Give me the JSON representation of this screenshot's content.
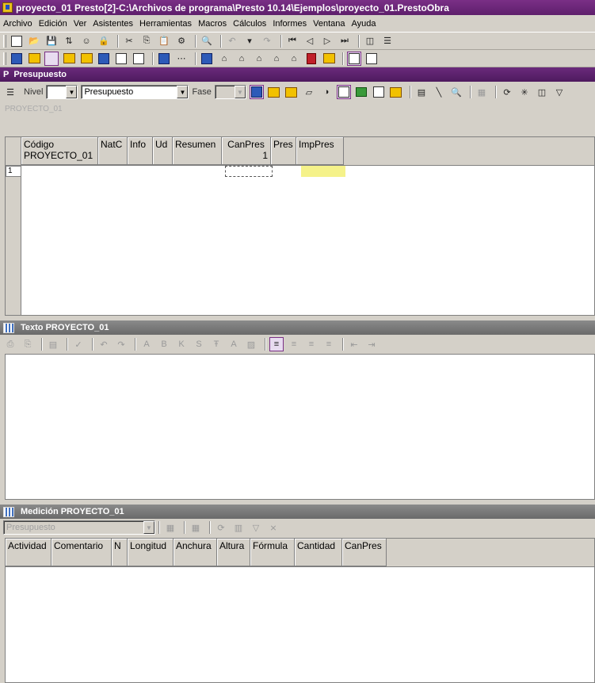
{
  "window": {
    "title": "proyecto_01 Presto[2]-C:\\Archivos de programa\\Presto 10.14\\Ejemplos\\proyecto_01.PrestoObra"
  },
  "menu": [
    "Archivo",
    "Edición",
    "Ver",
    "Asistentes",
    "Herramientas",
    "Macros",
    "Cálculos",
    "Informes",
    "Ventana",
    "Ayuda"
  ],
  "presupuesto": {
    "title_tag": "P",
    "title": "Presupuesto",
    "nivel_label": "Nivel",
    "nivel_value": "",
    "view_value": "Presupuesto",
    "fase_label": "Fase",
    "fase_value": "",
    "code_path": "PROYECTO_01",
    "columns": [
      {
        "h1": "Código",
        "h2": "PROYECTO_01"
      },
      {
        "h1": "NatC",
        "h2": ""
      },
      {
        "h1": "Info",
        "h2": ""
      },
      {
        "h1": "Ud",
        "h2": ""
      },
      {
        "h1": "Resumen",
        "h2": ""
      },
      {
        "h1": "CanPres",
        "h2": "1"
      },
      {
        "h1": "Pres",
        "h2": ""
      },
      {
        "h1": "ImpPres",
        "h2": ""
      }
    ],
    "row_number": "1"
  },
  "texto": {
    "title": "Texto PROYECTO_01"
  },
  "medicion": {
    "title": "Medición PROYECTO_01",
    "filter_value": "Presupuesto",
    "columns": [
      "Actividad",
      "Comentario",
      "N",
      "Longitud",
      "Anchura",
      "Altura",
      "Fórmula",
      "Cantidad",
      "CanPres"
    ]
  },
  "colors": {
    "title_bar": "#5e1f6c",
    "panel_title": "#4e1a5e",
    "highlight_cell": "#f5f28a"
  }
}
